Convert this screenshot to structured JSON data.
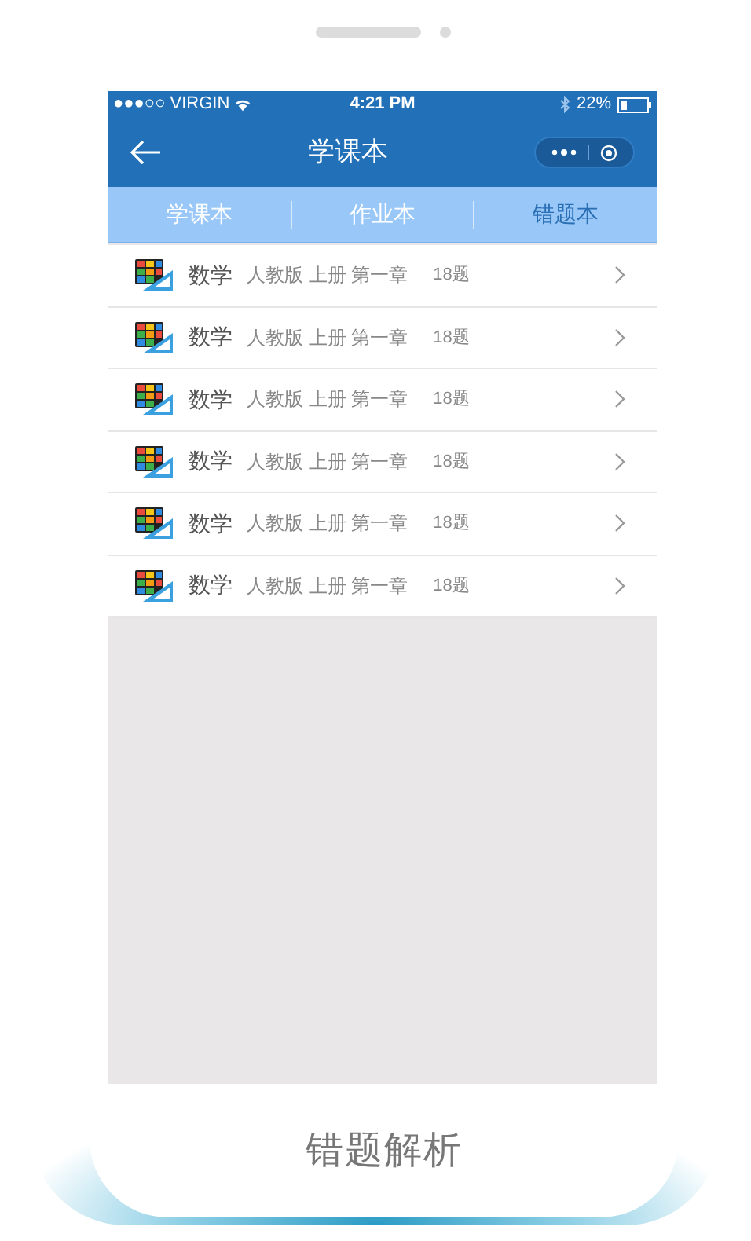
{
  "status_bar": {
    "carrier": "●●●○○ VIRGIN",
    "time": "4:21 PM",
    "battery": "22%"
  },
  "nav": {
    "title": "学课本"
  },
  "tabs": [
    {
      "label": "学课本",
      "selected": false
    },
    {
      "label": "作业本",
      "selected": false
    },
    {
      "label": "错题本",
      "selected": true
    }
  ],
  "rows": [
    {
      "subject": "数学",
      "details": "人教版 上册 第一章",
      "count": "18题"
    },
    {
      "subject": "数学",
      "details": "人教版 上册 第一章",
      "count": "18题"
    },
    {
      "subject": "数学",
      "details": "人教版 上册 第一章",
      "count": "18题"
    },
    {
      "subject": "数学",
      "details": "人教版 上册 第一章",
      "count": "18题"
    },
    {
      "subject": "数学",
      "details": "人教版 上册 第一章",
      "count": "18题"
    },
    {
      "subject": "数学",
      "details": "人教版 上册 第一章",
      "count": "18题"
    }
  ],
  "caption": "错题解析"
}
